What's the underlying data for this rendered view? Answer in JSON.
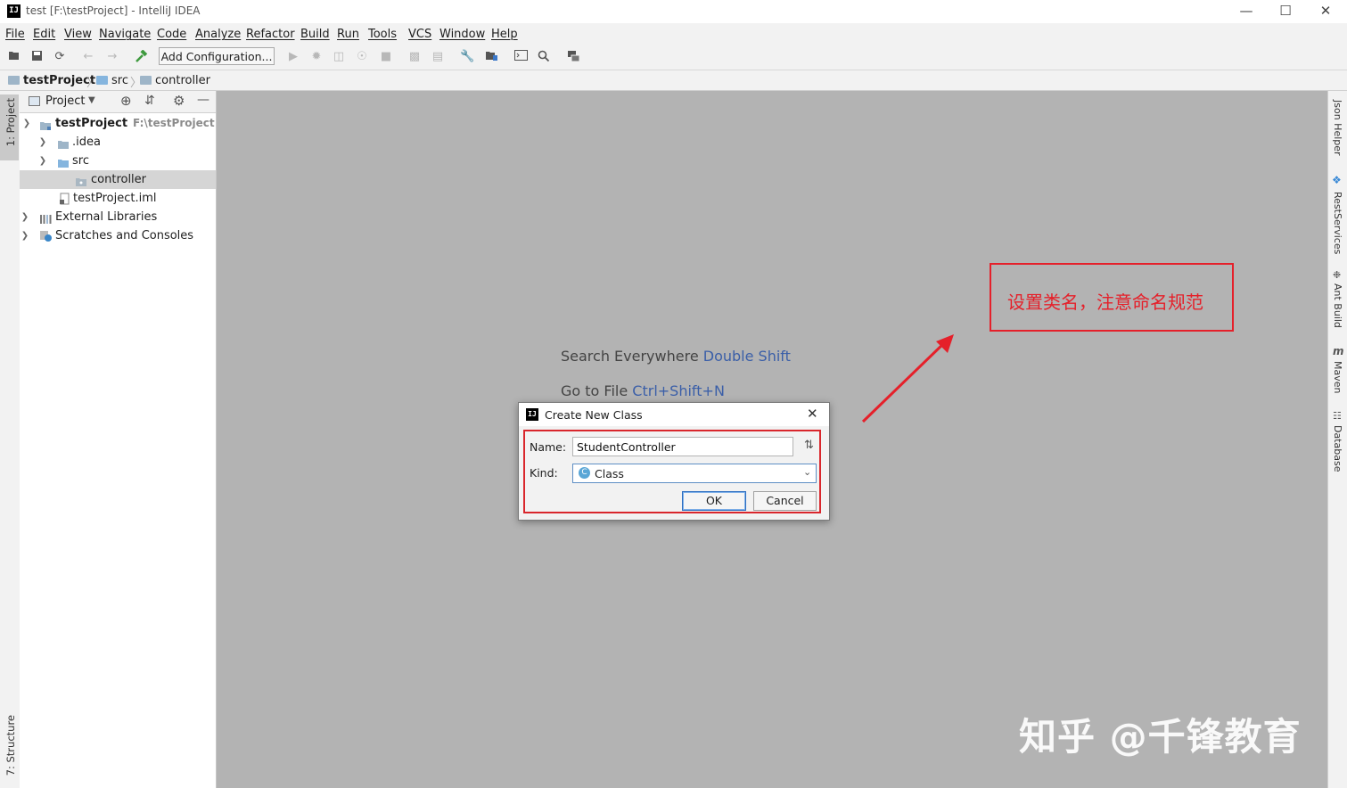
{
  "window": {
    "title": "test [F:\\testProject] - IntelliJ IDEA",
    "logo": "IJ",
    "controls": [
      "minimize-icon",
      "maximize-icon",
      "close-icon"
    ]
  },
  "menu": [
    "File",
    "Edit",
    "View",
    "Navigate",
    "Code",
    "Analyze",
    "Refactor",
    "Build",
    "Run",
    "Tools",
    "VCS",
    "Window",
    "Help"
  ],
  "toolbar": {
    "run_config_label": "Add Configuration...",
    "icons": [
      "open-folder-icon",
      "save-icon",
      "sync-icon",
      "back-icon",
      "forward-icon",
      "build-hammer-icon",
      "run-icon",
      "debug-icon",
      "coverage-icon",
      "profile-icon",
      "stop-icon",
      "vcs-update-icon",
      "vcs-commit-icon",
      "settings-wrench-icon",
      "project-structure-icon",
      "terminal-icon",
      "search-icon",
      "layout-icon"
    ]
  },
  "breadcrumb": [
    "testProject",
    "src",
    "controller"
  ],
  "left_strip": {
    "project_tab": "1: Project",
    "structure_tab": "7: Structure"
  },
  "right_strip": [
    "Json Helper",
    "RestServices",
    "Ant Build",
    "Maven",
    "Database"
  ],
  "project_panel": {
    "title": "Project",
    "tree": [
      {
        "label": "testProject",
        "path": "F:\\testProject",
        "depth": 0,
        "expanded": true
      },
      {
        "label": ".idea",
        "depth": 1,
        "expanded": false
      },
      {
        "label": "src",
        "depth": 1,
        "expanded": true
      },
      {
        "label": "controller",
        "depth": 2,
        "selected": true
      },
      {
        "label": "testProject.iml",
        "depth": 1
      },
      {
        "label": "External Libraries",
        "depth": 0,
        "expanded": false
      },
      {
        "label": "Scratches and Consoles",
        "depth": 0,
        "expanded": false
      }
    ]
  },
  "editor": {
    "hint1_text": "Search Everywhere",
    "hint1_key": "Double Shift",
    "hint2_text": "Go to File",
    "hint2_key": "Ctrl+Shift+N"
  },
  "annotation": {
    "text": "设置类名，注意命名规范",
    "color": "#e5202a"
  },
  "watermark": "知乎 @千锋教育",
  "dialog": {
    "title": "Create New Class",
    "name_label": "Name:",
    "name_value": "StudentController",
    "kind_label": "Kind:",
    "kind_value": "Class",
    "ok_label": "OK",
    "cancel_label": "Cancel"
  }
}
